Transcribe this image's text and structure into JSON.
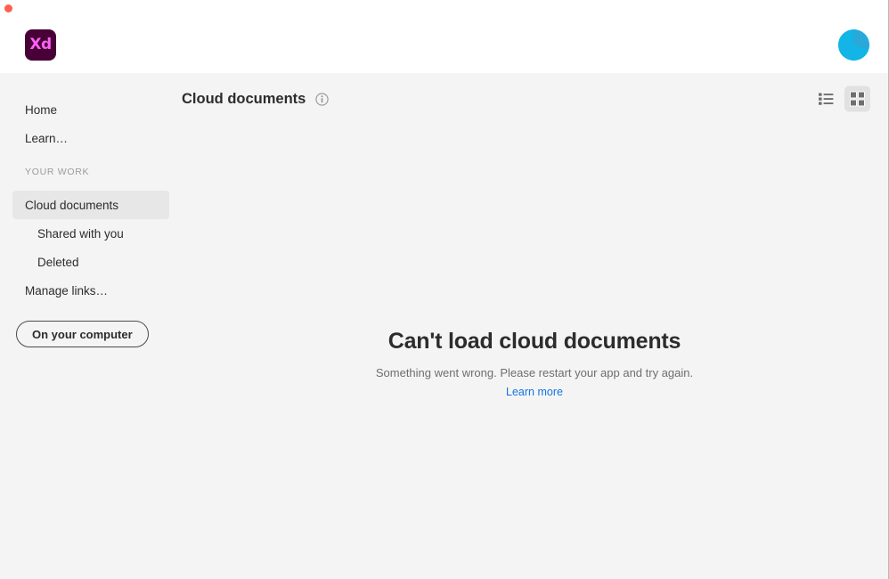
{
  "window": {
    "close_button": "close-window",
    "app_logo_text": "Xd",
    "app_logo_bg": "#470137",
    "app_logo_fg": "#ff61f6",
    "avatar_label": "user-avatar",
    "avatar_color": "#12b5e5"
  },
  "sidebar": {
    "items": [
      {
        "label": "Home",
        "level": "top",
        "selected": false
      },
      {
        "label": "Learn…",
        "level": "top",
        "selected": false
      }
    ],
    "section_label": "YOUR WORK",
    "work_items": [
      {
        "label": "Cloud documents",
        "level": "top",
        "selected": true
      },
      {
        "label": "Shared with you",
        "level": "sub",
        "selected": false
      },
      {
        "label": "Deleted",
        "level": "sub",
        "selected": false
      },
      {
        "label": "Manage links…",
        "level": "top",
        "selected": false
      }
    ],
    "local_button": "On your computer"
  },
  "main": {
    "title": "Cloud documents",
    "info_icon": "info-icon",
    "view_modes": [
      {
        "name": "list-view",
        "label": "List view",
        "active": false
      },
      {
        "name": "grid-view",
        "label": "Grid view",
        "active": true
      }
    ]
  },
  "empty_state": {
    "title": "Can't load cloud documents",
    "description": "Something went wrong. Please restart your app and try again.",
    "link": "Learn more",
    "link_color": "#1473e6"
  }
}
